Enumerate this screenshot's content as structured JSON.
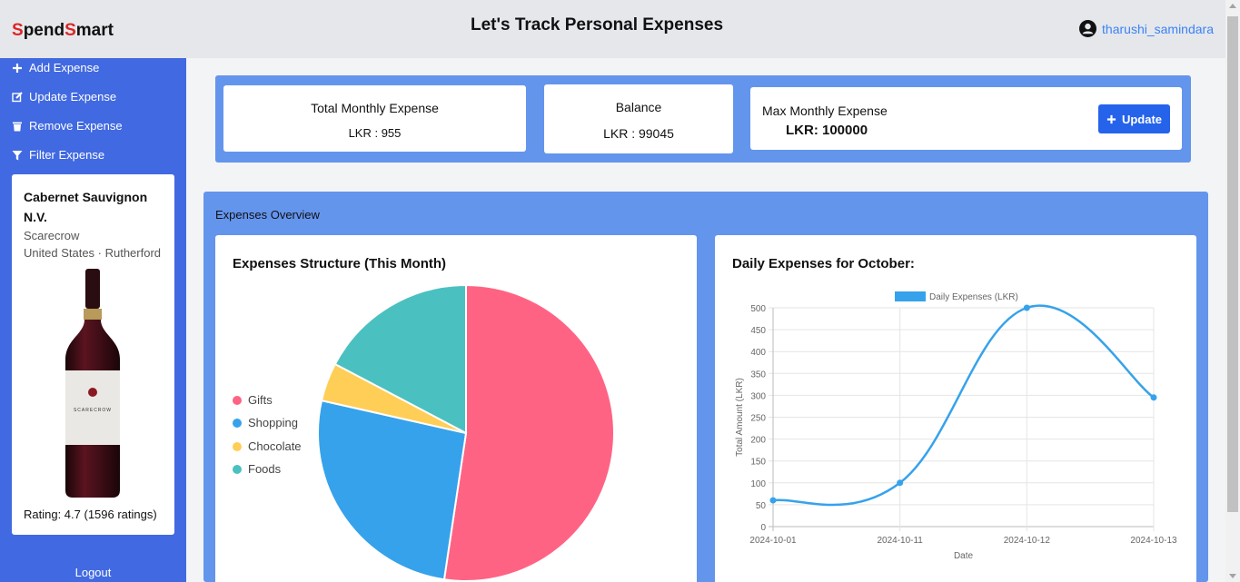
{
  "header": {
    "logo_s1": "S",
    "logo_part1": "pend",
    "logo_s2": "S",
    "logo_part2": "mart",
    "title": "Let's Track Personal Expenses",
    "username": "tharushi_samindara"
  },
  "sidebar": {
    "items": [
      {
        "label": "Add Expense",
        "icon": "plus-icon"
      },
      {
        "label": "Update Expense",
        "icon": "edit-icon"
      },
      {
        "label": "Remove Expense",
        "icon": "trash-icon"
      },
      {
        "label": "Filter Expense",
        "icon": "filter-icon"
      }
    ],
    "wine": {
      "name": "Cabernet Sauvignon N.V.",
      "winery": "Scarecrow",
      "location": "United States · Rutherford",
      "rating": "Rating: 4.7 (1596 ratings)"
    },
    "logout": "Logout"
  },
  "summary": {
    "total_title": "Total Monthly Expense",
    "total_value": "LKR : 955",
    "balance_title": "Balance",
    "balance_value": "LKR : 99045",
    "max_title": "Max Monthly Expense",
    "max_value": "LKR: 100000",
    "update_label": "Update"
  },
  "overview": {
    "title": "Expenses Overview",
    "pie_title": "Expenses Structure (This Month)",
    "line_title": "Daily Expenses for October:"
  },
  "colors": {
    "sidebar": "#4169e1",
    "panel": "#6495ed",
    "button": "#2563eb",
    "gifts": "#ff6384",
    "shopping": "#36a2eb",
    "chocolate": "#ffce56",
    "foods": "#4bc0c0"
  },
  "chart_data": [
    {
      "type": "pie",
      "title": "Expenses Structure (This Month)",
      "categories": [
        "Gifts",
        "Shopping",
        "Chocolate",
        "Foods"
      ],
      "values": [
        500,
        250,
        40,
        165
      ],
      "colors": [
        "#ff6384",
        "#36a2eb",
        "#ffce56",
        "#4bc0c0"
      ],
      "legend_position": "left"
    },
    {
      "type": "line",
      "title": "Daily Expenses for October:",
      "x": [
        "2024-10-01",
        "2024-10-11",
        "2024-10-12",
        "2024-10-13"
      ],
      "series": [
        {
          "name": "Daily Expenses (LKR)",
          "values": [
            60,
            100,
            500,
            295
          ],
          "color": "#36a2eb"
        }
      ],
      "xlabel": "Date",
      "ylabel": "Total Amount (LKR)",
      "ylim": [
        0,
        500
      ],
      "yticks": [
        0,
        50,
        100,
        150,
        200,
        250,
        300,
        350,
        400,
        450,
        500
      ],
      "grid": true,
      "legend_position": "top"
    }
  ]
}
